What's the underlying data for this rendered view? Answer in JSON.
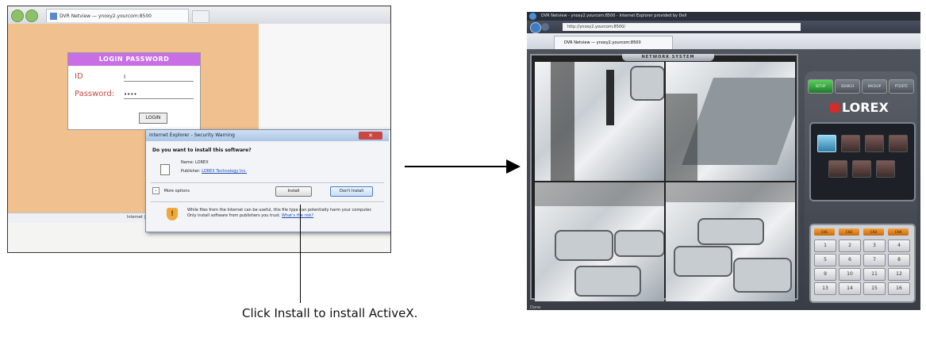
{
  "left_window": {
    "tab_title": "DVR Netview — ynoxy2.yourcom:8500",
    "login": {
      "header": "LOGIN PASSWORD",
      "id_label": "ID",
      "id_value": "I",
      "password_label": "Password:",
      "password_value": "••••",
      "login_button": "LOGIN"
    },
    "status_text": "Internet | Protected Mo",
    "dialog": {
      "title": "Internet Explorer - Security Warning",
      "close_label": "✕",
      "question": "Do you want to install this software?",
      "name_label": "Name:",
      "name_value": "LOREX",
      "publisher_label": "Publisher:",
      "publisher_value": "LOREX Technology Inc.",
      "more_options": "More options",
      "install_button": "Install",
      "dont_install_button": "Don't Install",
      "warning_text": "While files from the Internet can be useful, this file type can potentially harm your computer. Only install software from publishers you trust.",
      "risk_link": "What's the risk?"
    }
  },
  "callout": {
    "text": "Click Install to install ActiveX."
  },
  "right_window": {
    "title_bar": "DVR Netview - ynoxy2.yourcom:8500 - Internet Explorer provided by Dell",
    "address": "http://ynoxy2.yourcom:8500/",
    "tab_title": "DVR Netview — ynoxy2.yourcom:8500",
    "dvr_title": "NETWORK SYSTEM",
    "mode_buttons": [
      "SETUP",
      "SEARCH",
      "BACKUP",
      "PTZ/ETC"
    ],
    "brand": "LOREX",
    "channel_tabs": [
      "CH1",
      "CH2",
      "CH3",
      "CH4"
    ],
    "channel_numbers": [
      "1",
      "2",
      "3",
      "4",
      "5",
      "6",
      "7",
      "8",
      "9",
      "10",
      "11",
      "12",
      "13",
      "14",
      "15",
      "16"
    ],
    "status": "Done"
  },
  "colors": {
    "peach_background": "#f0c08e",
    "login_header": "#c86fe6",
    "lorex_red": "#d42b2b"
  }
}
